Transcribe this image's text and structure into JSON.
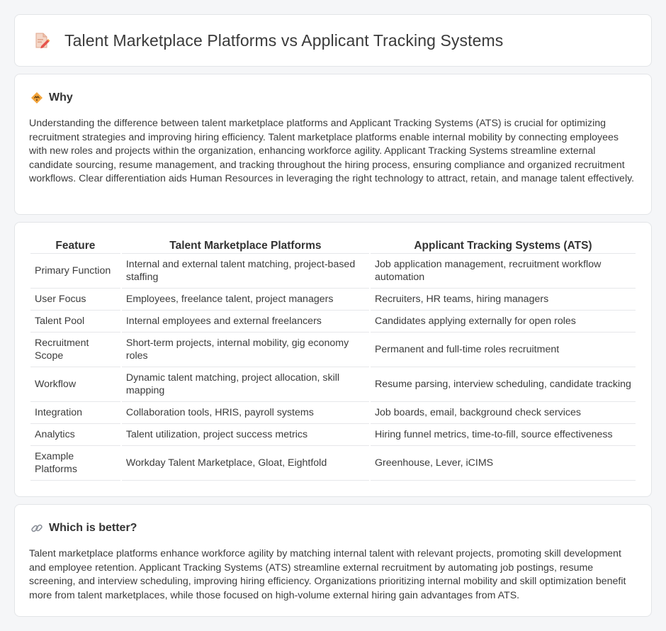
{
  "page": {
    "title": "Talent Marketplace Platforms vs Applicant Tracking Systems"
  },
  "why": {
    "heading": "Why",
    "body": "Understanding the difference between talent marketplace platforms and Applicant Tracking Systems (ATS) is crucial for optimizing recruitment strategies and improving hiring efficiency. Talent marketplace platforms enable internal mobility by connecting employees with new roles and projects within the organization, enhancing workforce agility. Applicant Tracking Systems streamline external candidate sourcing, resume management, and tracking throughout the hiring process, ensuring compliance and organized recruitment workflows. Clear differentiation aids Human Resources in leveraging the right technology to attract, retain, and manage talent effectively."
  },
  "table": {
    "headers": [
      "Feature",
      "Talent Marketplace Platforms",
      "Applicant Tracking Systems (ATS)"
    ],
    "rows": [
      [
        "Primary Function",
        "Internal and external talent matching, project-based staffing",
        "Job application management, recruitment workflow automation"
      ],
      [
        "User Focus",
        "Employees, freelance talent, project managers",
        "Recruiters, HR teams, hiring managers"
      ],
      [
        "Talent Pool",
        "Internal employees and external freelancers",
        "Candidates applying externally for open roles"
      ],
      [
        "Recruitment Scope",
        "Short-term projects, internal mobility, gig economy roles",
        "Permanent and full-time roles recruitment"
      ],
      [
        "Workflow",
        "Dynamic talent matching, project allocation, skill mapping",
        "Resume parsing, interview scheduling, candidate tracking"
      ],
      [
        "Integration",
        "Collaboration tools, HRIS, payroll systems",
        "Job boards, email, background check services"
      ],
      [
        "Analytics",
        "Talent utilization, project success metrics",
        "Hiring funnel metrics, time-to-fill, source effectiveness"
      ],
      [
        "Example Platforms",
        "Workday Talent Marketplace, Gloat, Eightfold",
        "Greenhouse, Lever, iCIMS"
      ]
    ]
  },
  "better": {
    "heading": "Which is better?",
    "body": "Talent marketplace platforms enhance workforce agility by matching internal talent with relevant projects, promoting skill development and employee retention. Applicant Tracking Systems (ATS) streamline external recruitment by automating job postings, resume screening, and interview scheduling, improving hiring efficiency. Organizations prioritizing internal mobility and skill optimization benefit more from talent marketplaces, while those focused on high-volume external hiring gain advantages from ATS."
  },
  "icons": {
    "title": "document-pencil-icon",
    "why": "diamond-sign-icon",
    "better": "link-icon"
  },
  "colors": {
    "accent_orange": "#f2a33a",
    "accent_red": "#e5534b",
    "border": "#e3e5e8",
    "background": "#f5f6f8"
  }
}
